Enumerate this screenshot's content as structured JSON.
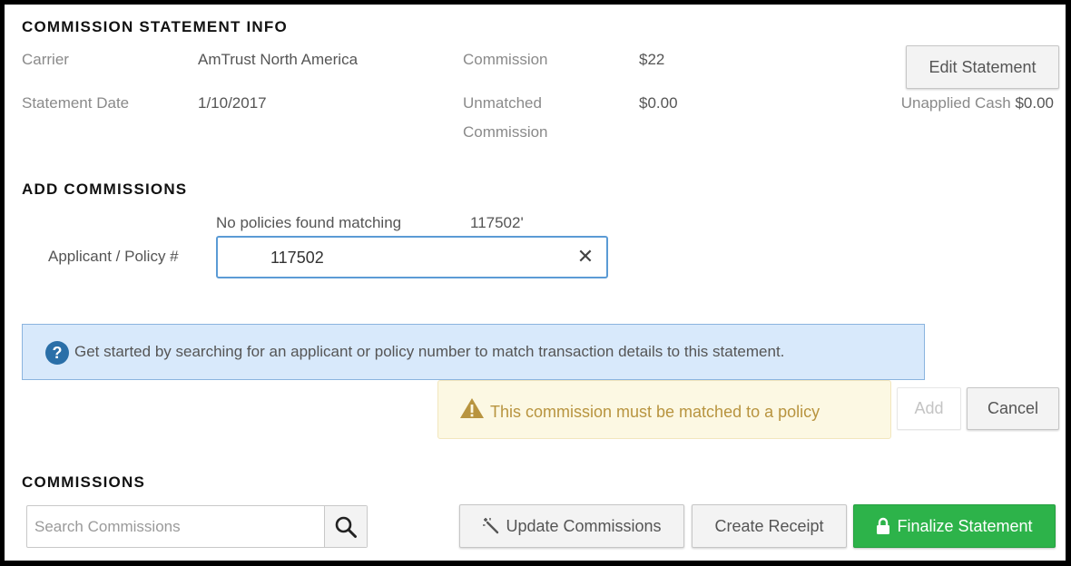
{
  "statement_info": {
    "title": "COMMISSION STATEMENT INFO",
    "carrier_label": "Carrier",
    "carrier_value": "AmTrust North America",
    "statement_date_label": "Statement Date",
    "statement_date_value": "1/10/2017",
    "commission_label": "Commission",
    "commission_value": "$22",
    "unmatched_label_line1": "Unmatched",
    "unmatched_label_line2": "Commission",
    "unmatched_value": "$0.00",
    "edit_button": "Edit Statement",
    "unapplied_cash_label": "Unapplied Cash",
    "unapplied_cash_value": "$0.00"
  },
  "add_commissions": {
    "title": "ADD COMMISSIONS",
    "no_results_text": "No policies found matching",
    "no_results_query": "117502'",
    "field_label": "Applicant / Policy #",
    "field_value": "117502",
    "info_message": "Get started by searching for an applicant or policy number to match transaction details to this statement.",
    "warning_message": "This commission must be matched to a policy",
    "add_button": "Add",
    "cancel_button": "Cancel"
  },
  "commissions": {
    "title": "COMMISSIONS",
    "search_placeholder": "Search Commissions",
    "update_button": "Update Commissions",
    "receipt_button": "Create Receipt",
    "finalize_button": "Finalize Statement"
  },
  "icons": {
    "clear": "close-icon",
    "info": "question-circle-icon",
    "warning": "warning-triangle-icon",
    "search": "search-icon",
    "update": "magic-wand-icon",
    "finalize": "lock-icon"
  },
  "colors": {
    "primary_green": "#2db34a",
    "info_background": "#d8e9fb",
    "info_icon": "#2a6fa8",
    "warning_background": "#fcf8e3",
    "warning_text": "#b8943f",
    "focus_border": "#5b9bd5"
  }
}
